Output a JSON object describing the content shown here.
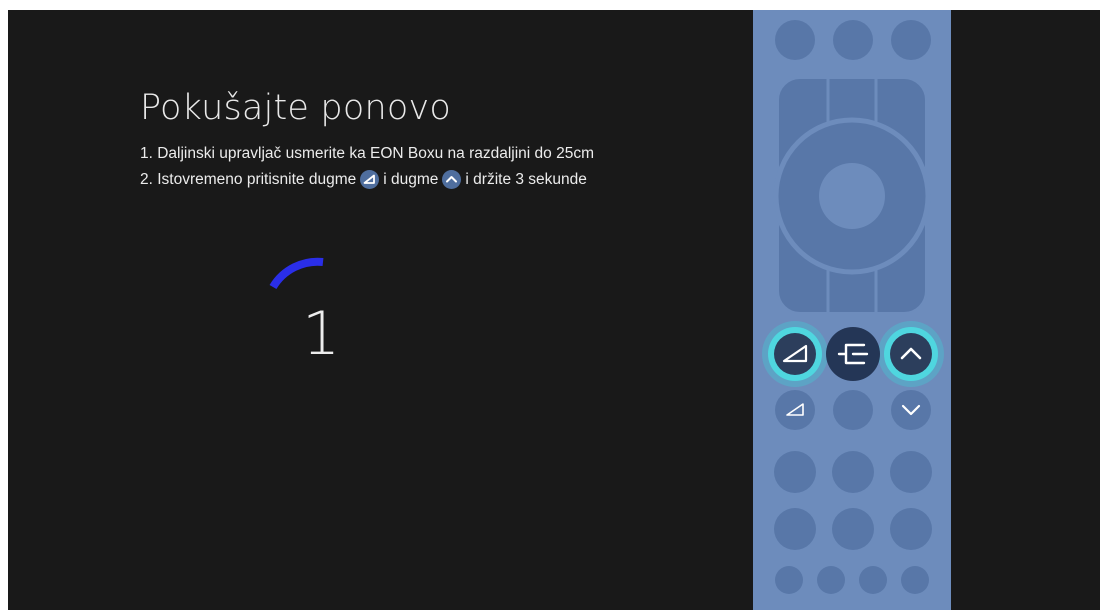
{
  "screen": {
    "title": "Pokušajte ponovo",
    "instructions": {
      "line1": "1. Daljinski upravljač usmerite ka EON Boxu na razdaljini do 25cm",
      "line2_part1": "2. Istovremeno pritisnite dugme",
      "line2_part2": "i dugme",
      "line2_part3": "i držite 3 sekunde",
      "button_icon_1": "volume-ramp-icon",
      "button_icon_2": "chevron-up-icon"
    },
    "countdown": "1",
    "progress_fraction": 0.14
  },
  "remote": {
    "highlighted_buttons": [
      "volume-ramp-icon",
      "chevron-up-icon"
    ],
    "center_icon": "input-source-icon"
  },
  "colors": {
    "background": "#191919",
    "remote_body": "#6d8cbc",
    "remote_button": "#5877a8",
    "highlight_glow": "#4fd6df",
    "spinner_arc": "#2a2ee8",
    "text": "#ececec"
  }
}
